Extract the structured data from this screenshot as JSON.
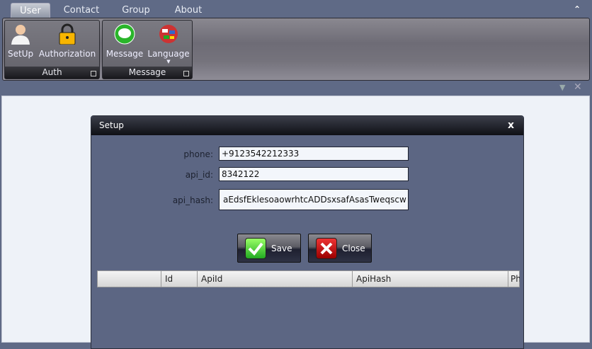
{
  "tabs": [
    "User",
    "Contact",
    "Group",
    "About"
  ],
  "ribbon": {
    "groups": [
      {
        "label": "Auth",
        "items": [
          "SetUp",
          "Authorization"
        ]
      },
      {
        "label": "Message",
        "items": [
          "Message",
          "Language"
        ]
      }
    ]
  },
  "dialog": {
    "title": "Setup",
    "close": "x",
    "fields": [
      {
        "label": "phone:",
        "value": "+9123542212333"
      },
      {
        "label": "api_id:",
        "value": "8342122"
      },
      {
        "label": "api_hash:",
        "value": "aEdsfEklesoaowrhtcADDsxsafAsasTweqscw"
      }
    ],
    "save": "Save",
    "close_button": "Close",
    "grid_columns": [
      "",
      "Id",
      "ApiId",
      "ApiHash",
      "Ph"
    ]
  }
}
